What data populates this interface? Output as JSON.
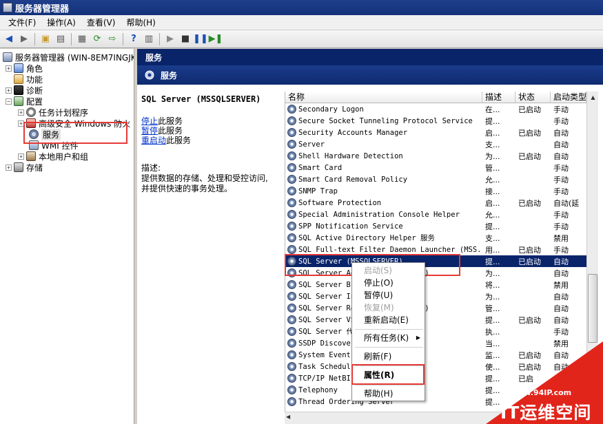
{
  "window": {
    "title": "服务器管理器"
  },
  "menu": [
    "文件(F)",
    "操作(A)",
    "查看(V)",
    "帮助(H)"
  ],
  "tree": {
    "root": "服务器管理器 (WIN-8EM7INGJKI",
    "items": [
      {
        "label": "角色",
        "icon": "role-icon"
      },
      {
        "label": "功能",
        "icon": "feature-icon"
      },
      {
        "label": "诊断",
        "icon": "diagnostics-icon"
      },
      {
        "label": "配置",
        "icon": "config-icon"
      },
      {
        "label": "任务计划程序",
        "icon": "clock-icon"
      },
      {
        "label": "高级安全 Windows 防火",
        "icon": "firewall-icon"
      },
      {
        "label": "服务",
        "icon": "gear-icon"
      },
      {
        "label": "WMI 控件",
        "icon": "wmi-icon"
      },
      {
        "label": "本地用户和组",
        "icon": "users-icon"
      },
      {
        "label": "存储",
        "icon": "storage-icon"
      }
    ]
  },
  "panel": {
    "header": "服务",
    "sub_header": "服务",
    "selected_service": "SQL Server (MSSQLSERVER)",
    "links": [
      {
        "underlined": "停止",
        "rest": "此服务"
      },
      {
        "underlined": "暂停",
        "rest": "此服务"
      },
      {
        "underlined": "重启动",
        "rest": "此服务"
      }
    ],
    "desc_label": "描述:",
    "desc_lines": [
      "提供数据的存储、处理和受控访问,",
      "并提供快速的事务处理。"
    ]
  },
  "columns": {
    "name": "名称",
    "desc": "描述",
    "status": "状态",
    "startup": "启动类型"
  },
  "services": [
    {
      "name": "Secondary Logon",
      "desc": "在...",
      "status": "已启动",
      "startup": "手动"
    },
    {
      "name": "Secure Socket Tunneling Protocol Service",
      "desc": "提...",
      "status": "",
      "startup": "手动"
    },
    {
      "name": "Security Accounts Manager",
      "desc": "启...",
      "status": "已启动",
      "startup": "自动"
    },
    {
      "name": "Server",
      "desc": "支...",
      "status": "",
      "startup": "自动"
    },
    {
      "name": "Shell Hardware Detection",
      "desc": "为...",
      "status": "已启动",
      "startup": "自动"
    },
    {
      "name": "Smart Card",
      "desc": "管...",
      "status": "",
      "startup": "手动"
    },
    {
      "name": "Smart Card Removal Policy",
      "desc": "允...",
      "status": "",
      "startup": "手动"
    },
    {
      "name": "SNMP Trap",
      "desc": "接...",
      "status": "",
      "startup": "手动"
    },
    {
      "name": "Software Protection",
      "desc": "启...",
      "status": "已启动",
      "startup": "自动(延"
    },
    {
      "name": "Special Administration Console Helper",
      "desc": "允...",
      "status": "",
      "startup": "手动"
    },
    {
      "name": "SPP Notification Service",
      "desc": "提...",
      "status": "",
      "startup": "手动"
    },
    {
      "name": "SQL Active Directory Helper 服务",
      "desc": "支...",
      "status": "",
      "startup": "禁用"
    },
    {
      "name": "SQL Full-text Filter Daemon Launcher (MSS...",
      "desc": "用...",
      "status": "已启动",
      "startup": "手动"
    },
    {
      "name": "SQL Server (MSSQLSERVER)",
      "desc": "提...",
      "status": "已启动",
      "startup": "自动"
    },
    {
      "name": "SQL Server Ag... (MSSQLSERVER)",
      "desc": "为...",
      "status": "",
      "startup": "自动"
    },
    {
      "name": "SQL Server Br...",
      "desc": "将...",
      "status": "",
      "startup": "禁用"
    },
    {
      "name": "SQL Server In... 10.0",
      "desc": "为...",
      "status": "",
      "startup": "自动"
    },
    {
      "name": "SQL Server Re... (MSSQLSERVER)",
      "desc": "管...",
      "status": "",
      "startup": "自动"
    },
    {
      "name": "SQL Server VS...",
      "desc": "提...",
      "status": "已启动",
      "startup": "自动"
    },
    {
      "name": "SQL Server 代...",
      "desc": "执...",
      "status": "",
      "startup": "手动"
    },
    {
      "name": "SSDP Discover...",
      "desc": "当...",
      "status": "",
      "startup": "禁用"
    },
    {
      "name": "System Event... ce",
      "desc": "监...",
      "status": "已启动",
      "startup": "自动"
    },
    {
      "name": "Task Schedul...",
      "desc": "使...",
      "status": "已启动",
      "startup": "自动"
    },
    {
      "name": "TCP/IP NetBI...",
      "desc": "提...",
      "status": "已启",
      "startup": ""
    },
    {
      "name": "Telephony",
      "desc": "提...",
      "status": "",
      "startup": ""
    },
    {
      "name": "Thread Ordering Server",
      "desc": "提...",
      "status": "",
      "startup": ""
    }
  ],
  "selected_index": 13,
  "context_menu": {
    "start": "启动(S)",
    "stop": "停止(O)",
    "pause": "暂停(U)",
    "resume": "恢复(M)",
    "restart": "重新启动(E)",
    "all_tasks": "所有任务(K)",
    "refresh": "刷新(F)",
    "properties": "属性(R)",
    "help": "帮助(H)"
  },
  "watermark": {
    "url": "www.94IP.com",
    "brand": "IT运维空间"
  }
}
